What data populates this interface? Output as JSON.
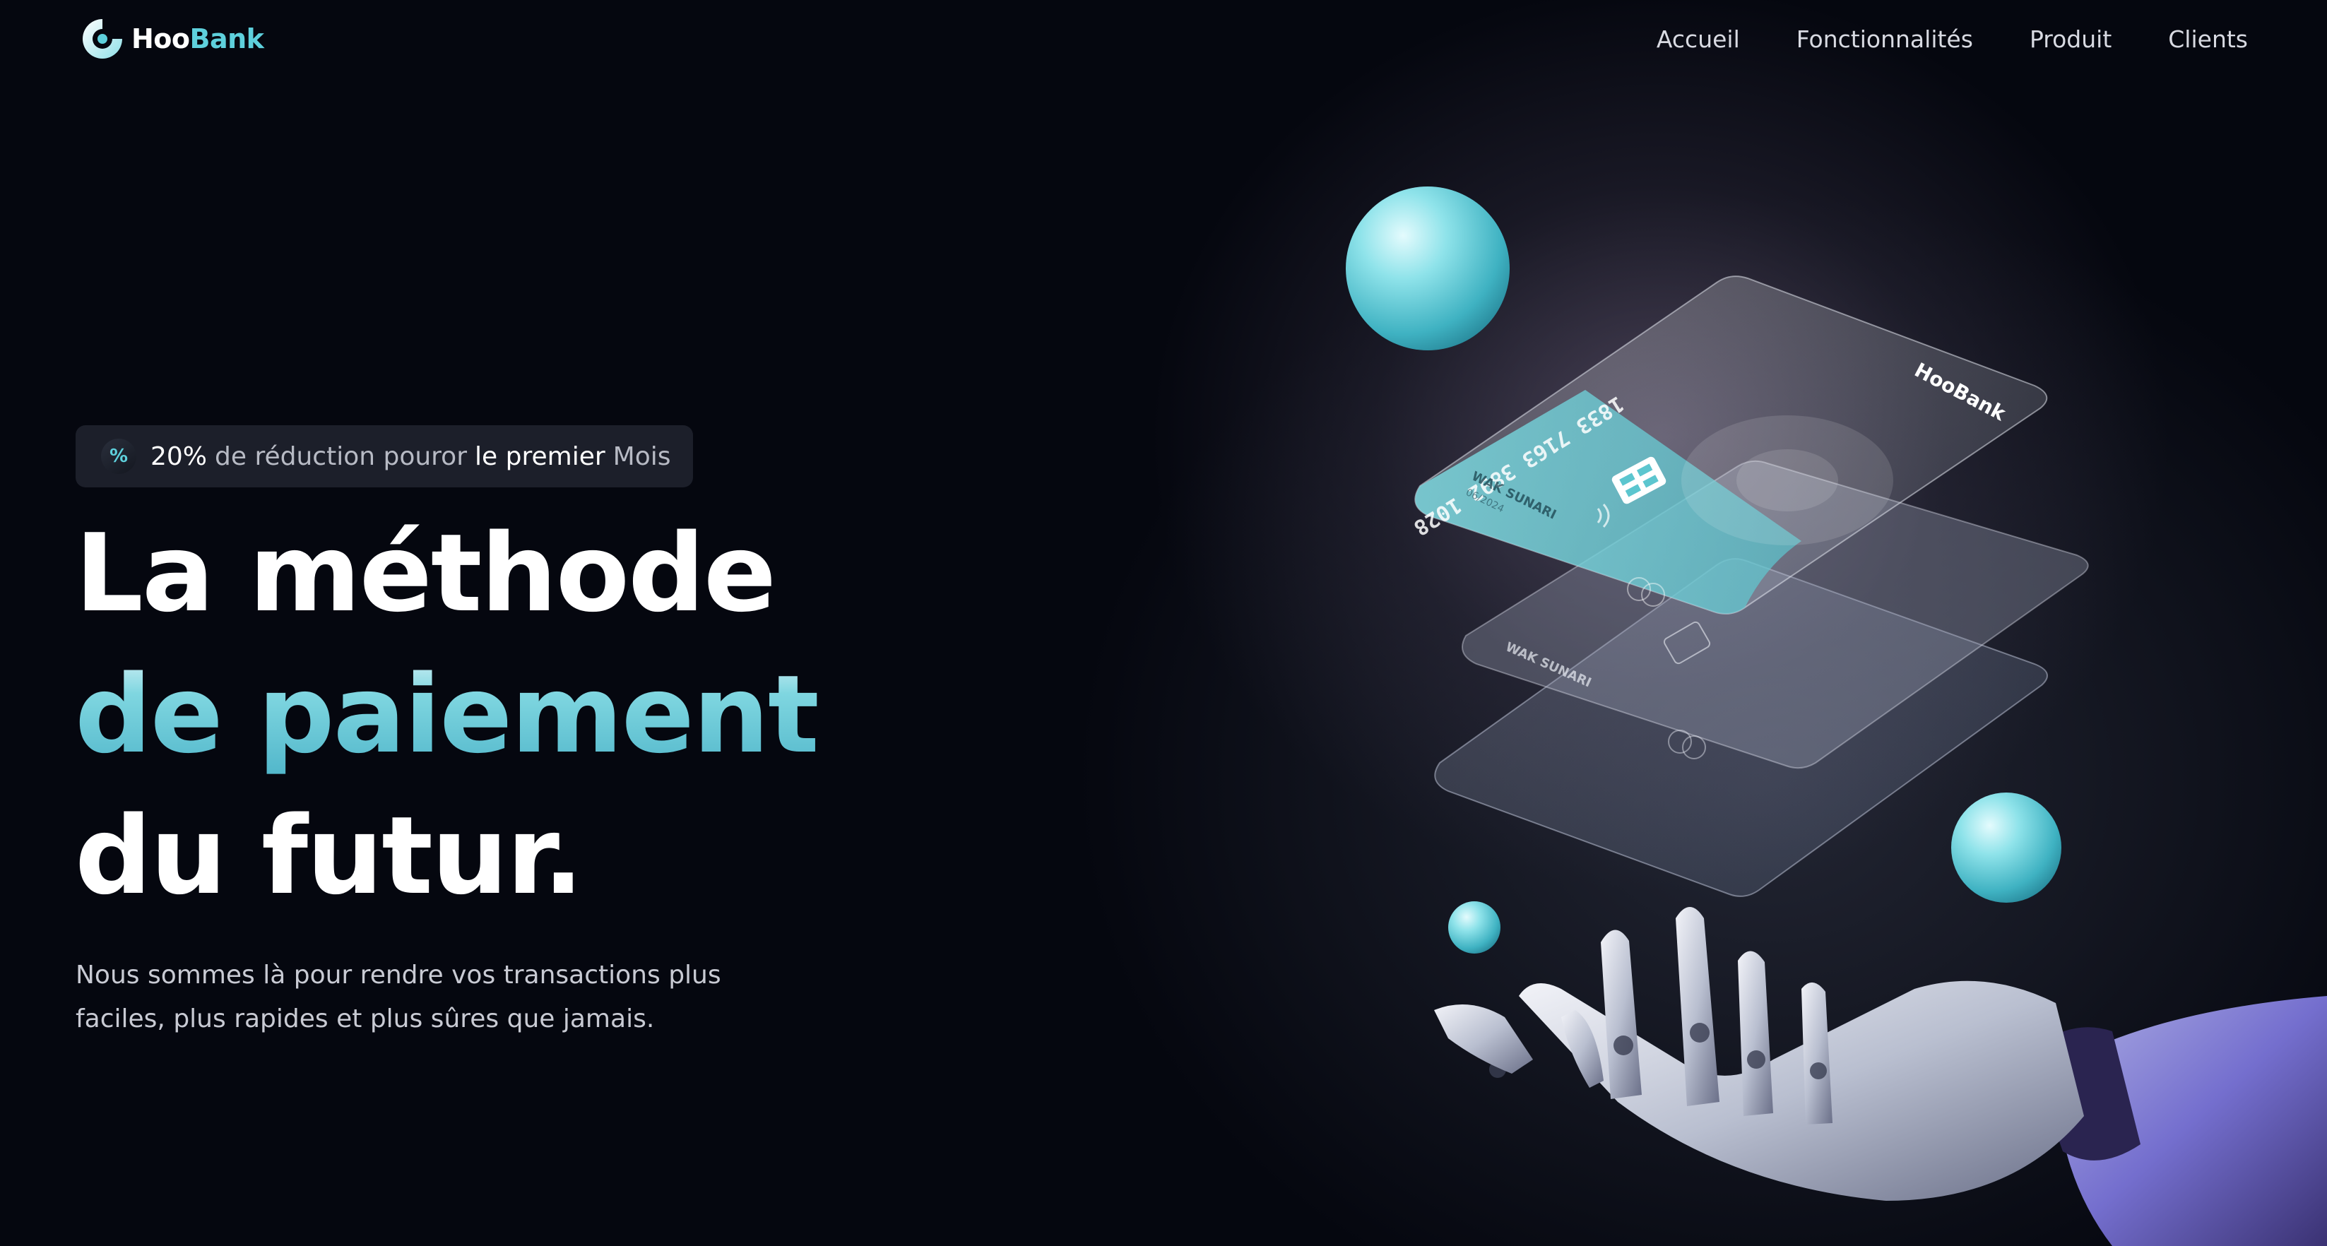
{
  "brand": {
    "name_part1": "Hoo",
    "name_part2": "Bank",
    "accent": "#5ed0dc"
  },
  "nav": {
    "items": [
      "Accueil",
      "Fonctionnalités",
      "Produit",
      "Clients"
    ]
  },
  "badge": {
    "icon": "discount-icon",
    "percent": "20%",
    "text1": "de réduction pouror",
    "highlight": "le premier",
    "text2": "Mois"
  },
  "hero": {
    "line1": "La méthode",
    "line2": "de paiement",
    "line3": "du futur.",
    "subtitle": "Nous sommes là pour rendre vos transactions plus faciles, plus rapides et plus sûres que jamais."
  },
  "card": {
    "number": "1833 7163 3892 1028",
    "holder": "WAK SUNARI",
    "expiry": "06/2024",
    "brand": "HooBank"
  }
}
